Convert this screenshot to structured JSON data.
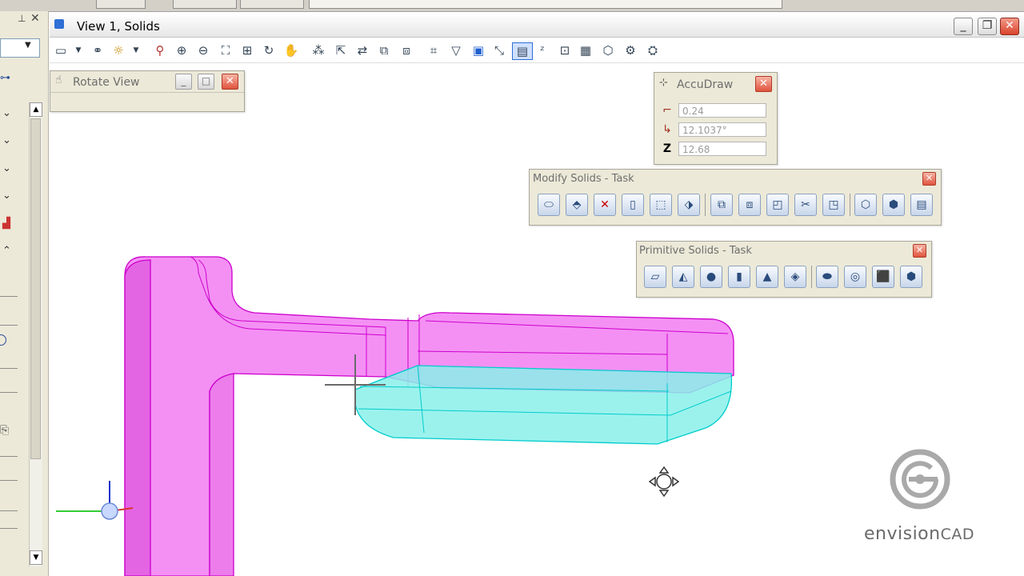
{
  "view_window": {
    "title": "View 1, Solids",
    "minimize": "_",
    "restore": "❐",
    "close": "✕"
  },
  "toolbar": {
    "icons": [
      "update-view-icon",
      "view-attributes-icon",
      "display-style-icon",
      "zoom-in-icon",
      "zoom-out-icon",
      "window-area-icon",
      "fit-view-icon",
      "rotate-view-icon",
      "pan-view-icon",
      "walk-icon",
      "view-previous-icon",
      "view-next-icon",
      "copy-view-icon",
      "clip-volume-icon",
      "clip-mask-icon",
      "display-rules-icon",
      "camera-icon",
      "render-icon",
      "view-rotation-icon",
      "lock-icon",
      "z-depth-icon",
      "solids-icon",
      "cube-icon",
      "analyze-icon",
      "settings-icon"
    ]
  },
  "rotate_view": {
    "title": "Rotate View"
  },
  "accudraw": {
    "title": "AccuDraw",
    "distance": "0.24",
    "angle": "12.1037°",
    "z": "12.68",
    "z_label": "Z"
  },
  "modify_solids": {
    "title": "Modify Solids - Task",
    "tools": [
      "extrude-face-icon",
      "modify-edge-icon",
      "delete-face-icon",
      "shell-solid-icon",
      "thicken-icon",
      "cut-solid-icon",
      "unite-icon",
      "intersect-icon",
      "subtract-icon",
      "cut-by-curves-icon",
      "construct-fillet-icon",
      "blend-icon",
      "chamfer-icon",
      "imprint-icon"
    ]
  },
  "primitive_solids": {
    "title": "Primitive Solids - Task",
    "tools": [
      "slab-icon",
      "wedge-icon",
      "sphere-icon",
      "cylinder-icon",
      "cone-icon",
      "torus-wedge-icon",
      "ellipsoid-icon",
      "torus-icon",
      "box-icon",
      "polyhedron-icon"
    ]
  },
  "logo": {
    "text_main": "envision",
    "text_accent": "CAD"
  },
  "colors": {
    "solid_magenta": "#f27cf2",
    "solid_edge": "#cc00cc",
    "cyan_fill": "#8af0ea",
    "cyan_edge": "#00cccc",
    "dialog_bg": "#ece9d8"
  }
}
